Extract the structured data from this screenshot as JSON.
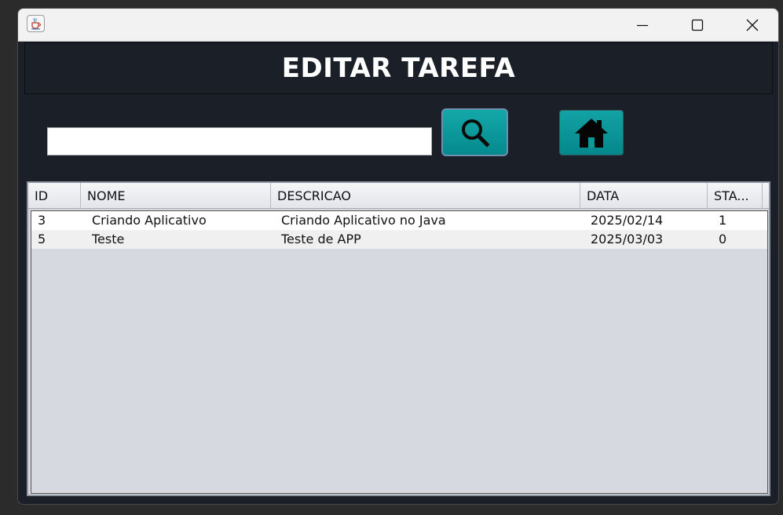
{
  "window": {
    "app_icon": "java-cup-icon",
    "controls": {
      "minimize": "minimize-icon",
      "maximize": "maximize-icon",
      "close": "close-icon"
    }
  },
  "header": {
    "title": "EDITAR TAREFA"
  },
  "search": {
    "value": "",
    "placeholder": "",
    "button_icon": "search-icon"
  },
  "home": {
    "button_icon": "home-icon"
  },
  "colors": {
    "background": "#1b1f27",
    "button_teal": "#0a9a9c",
    "table_bg": "#d6d9e0"
  },
  "table": {
    "columns": [
      "ID",
      "NOME",
      "DESCRICAO",
      "DATA",
      "STA..."
    ],
    "rows": [
      {
        "id": "3",
        "nome": "Criando Aplicativo",
        "descricao": "Criando Aplicativo no Java",
        "data": "2025/02/14",
        "status": "1"
      },
      {
        "id": "5",
        "nome": "Teste",
        "descricao": "Teste de APP",
        "data": "2025/03/03",
        "status": "0"
      }
    ]
  }
}
